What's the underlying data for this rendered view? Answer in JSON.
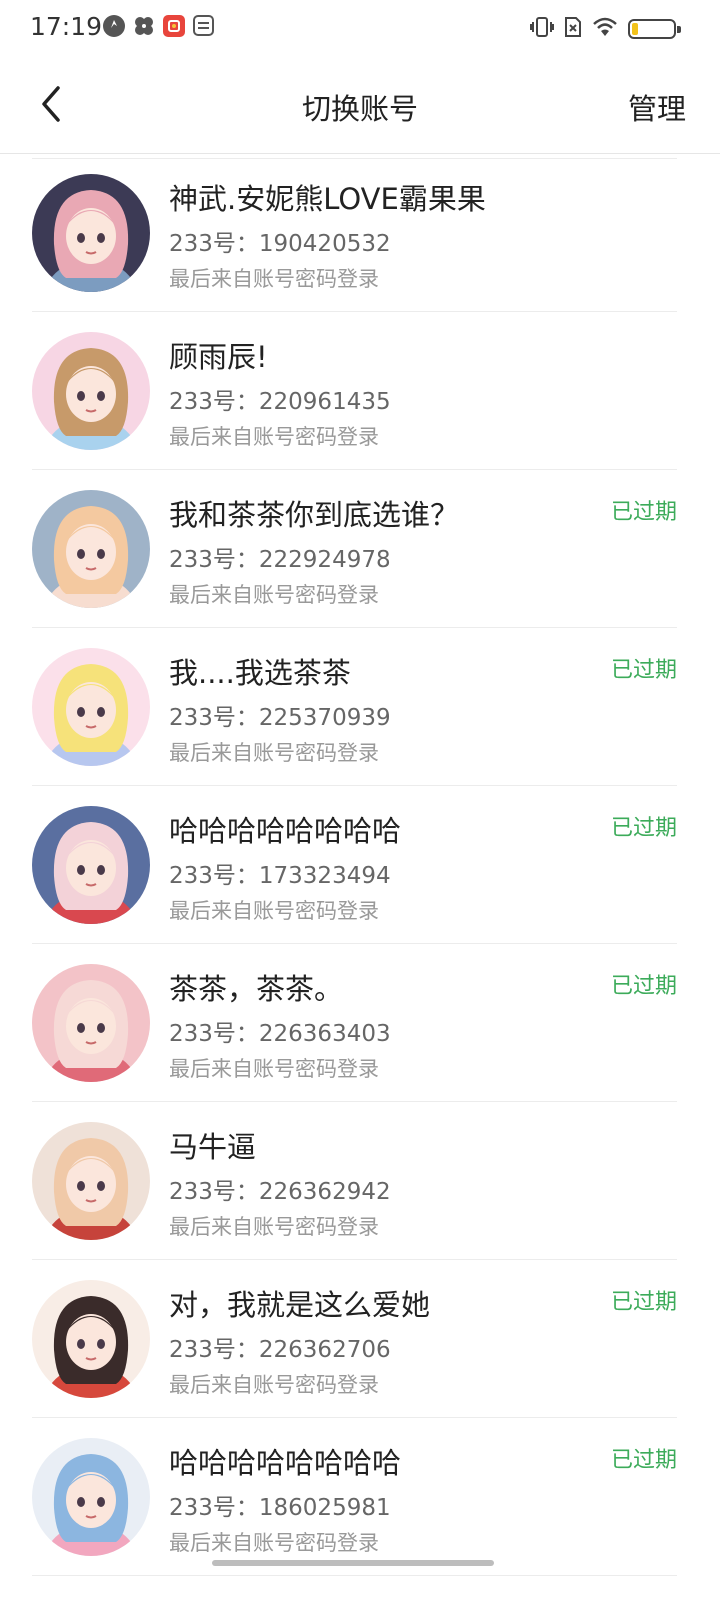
{
  "status_bar": {
    "time": "17:19",
    "battery_level": 0.15,
    "icons": [
      "clock-app-icon",
      "pinwheel-app-icon",
      "red-app-icon",
      "card-app-icon",
      "vibrate-icon",
      "no-sim-icon",
      "wifi-icon",
      "battery-icon"
    ]
  },
  "nav": {
    "title": "切换账号",
    "manage_label": "管理",
    "back_icon": "chevron-left-icon"
  },
  "accounts": [
    {
      "name": "神武.安妮熊LOVE霸果果",
      "id": "233号：190420532",
      "login": "最后来自账号密码登录",
      "expired": "",
      "avatar_colors": [
        "#3c3a55",
        "#e9a8b4",
        "#7c9cc0"
      ]
    },
    {
      "name": "顾雨辰!",
      "id": "233号：220961435",
      "login": "最后来自账号密码登录",
      "expired": "",
      "avatar_colors": [
        "#f7d6e4",
        "#c79a6a",
        "#a9d2ee"
      ]
    },
    {
      "name": "我和茶茶你到底选谁？",
      "id": "233号：222924978",
      "login": "最后来自账号密码登录",
      "expired": "已过期",
      "avatar_colors": [
        "#9fb3c8",
        "#f4c9a0",
        "#f7ddd0"
      ]
    },
    {
      "name": "我....我选茶茶",
      "id": "233号：225370939",
      "login": "最后来自账号密码登录",
      "expired": "已过期",
      "avatar_colors": [
        "#fbe0ea",
        "#f6e27a",
        "#b7c7ef"
      ]
    },
    {
      "name": "哈哈哈哈哈哈哈哈",
      "id": "233号：173323494",
      "login": "最后来自账号密码登录",
      "expired": "已过期",
      "avatar_colors": [
        "#5a6fa0",
        "#f3d2d8",
        "#d9484f"
      ]
    },
    {
      "name": "茶茶，茶茶。",
      "id": "233号：226363403",
      "login": "最后来自账号密码登录",
      "expired": "已过期",
      "avatar_colors": [
        "#f3c3c8",
        "#f6d9d6",
        "#e06a78"
      ]
    },
    {
      "name": "马牛逼",
      "id": "233号：226362942",
      "login": "最后来自账号密码登录",
      "expired": "",
      "avatar_colors": [
        "#efe1d8",
        "#f0c9a8",
        "#c6433b"
      ]
    },
    {
      "name": "对，我就是这么爱她",
      "id": "233号：226362706",
      "login": "最后来自账号密码登录",
      "expired": "已过期",
      "avatar_colors": [
        "#f8ede6",
        "#3a2b2a",
        "#d6483c"
      ]
    },
    {
      "name": "哈哈哈哈哈哈哈哈",
      "id": "233号：186025981",
      "login": "最后来自账号密码登录",
      "expired": "已过期",
      "avatar_colors": [
        "#e9eef5",
        "#8cb6e0",
        "#f2a7bf"
      ]
    }
  ],
  "colors": {
    "accent_green": "#3cab5a",
    "divider": "#ececec"
  }
}
